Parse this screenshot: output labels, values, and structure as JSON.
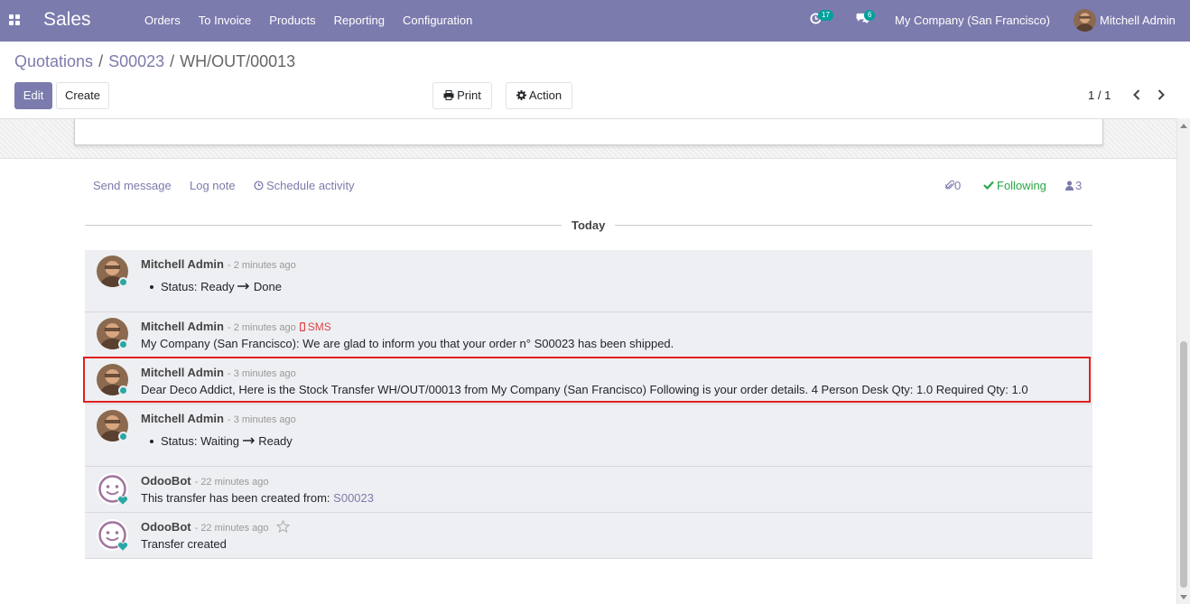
{
  "navbar": {
    "app_name": "Sales",
    "menu": [
      "Orders",
      "To Invoice",
      "Products",
      "Reporting",
      "Configuration"
    ],
    "activity_count": "17",
    "message_count": "6",
    "company": "My Company (San Francisco)",
    "user": "Mitchell Admin"
  },
  "breadcrumb": {
    "items": [
      "Quotations",
      "S00023",
      "WH/OUT/00013"
    ],
    "separator": "/"
  },
  "toolbar": {
    "edit_label": "Edit",
    "create_label": "Create",
    "print_label": "Print",
    "action_label": "Action",
    "pager": "1 / 1"
  },
  "chatter": {
    "send_message": "Send message",
    "log_note": "Log note",
    "schedule_activity": "Schedule activity",
    "attachments": "0",
    "following": "Following",
    "followers": "3",
    "date_separator": "Today"
  },
  "messages": [
    {
      "author": "Mitchell Admin",
      "time": "- 2 minutes ago",
      "tracking": "Status: Ready",
      "tracking_new": "Done"
    },
    {
      "author": "Mitchell Admin",
      "time": "- 2 minutes ago",
      "sms": "SMS",
      "body": "My Company (San Francisco): We are glad to inform you that your order n° S00023 has been shipped."
    },
    {
      "author": "Mitchell Admin",
      "time": "- 3 minutes ago",
      "body": "Dear Deco Addict, Here is the Stock Transfer WH/OUT/00013 from My Company (San Francisco) Following is your order details. 4 Person Desk Qty: 1.0 Required Qty: 1.0"
    },
    {
      "author": "Mitchell Admin",
      "time": "- 3 minutes ago",
      "tracking": "Status: Waiting",
      "tracking_new": "Ready"
    },
    {
      "author": "OdooBot",
      "time": "- 22 minutes ago",
      "body": "This transfer has been created from:",
      "link": "S00023"
    },
    {
      "author": "OdooBot",
      "time": "- 22 minutes ago",
      "body": "Transfer created"
    }
  ],
  "colors": {
    "brand": "#7c7bad",
    "badge": "#00a09d",
    "following": "#28a745",
    "highlight": "#e02020",
    "sms": "#dd4444"
  }
}
